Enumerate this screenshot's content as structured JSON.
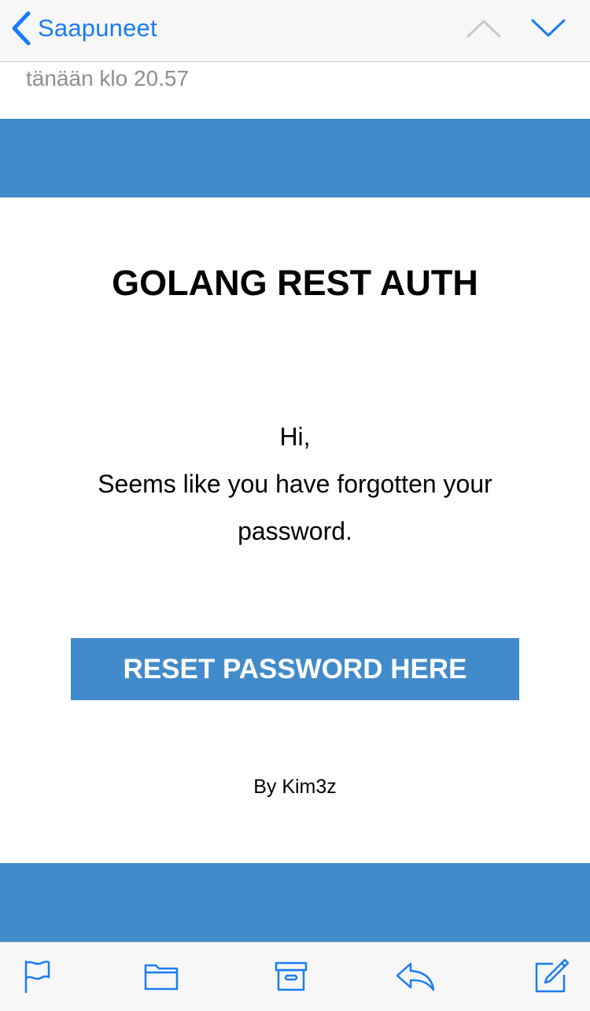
{
  "nav": {
    "back_label": "Saapuneet",
    "back_icon": "chevron-left-icon",
    "prev_icon": "chevron-up-icon",
    "next_icon": "chevron-down-icon"
  },
  "message": {
    "date": "tänään klo 20.57"
  },
  "email": {
    "title": "GOLANG REST AUTH",
    "greeting": "Hi,",
    "body": "Seems like you have forgotten your password.",
    "button_label": "RESET PASSWORD HERE",
    "signature": "By Kim3z"
  },
  "toolbar": {
    "icons": [
      "flag-icon",
      "folder-icon",
      "archive-icon",
      "reply-icon",
      "compose-icon"
    ]
  },
  "colors": {
    "accent": "#1a7cf5",
    "email_brand": "#428bca",
    "nav_disabled": "#c7c7cc",
    "secondary_text": "#8e8e93"
  }
}
